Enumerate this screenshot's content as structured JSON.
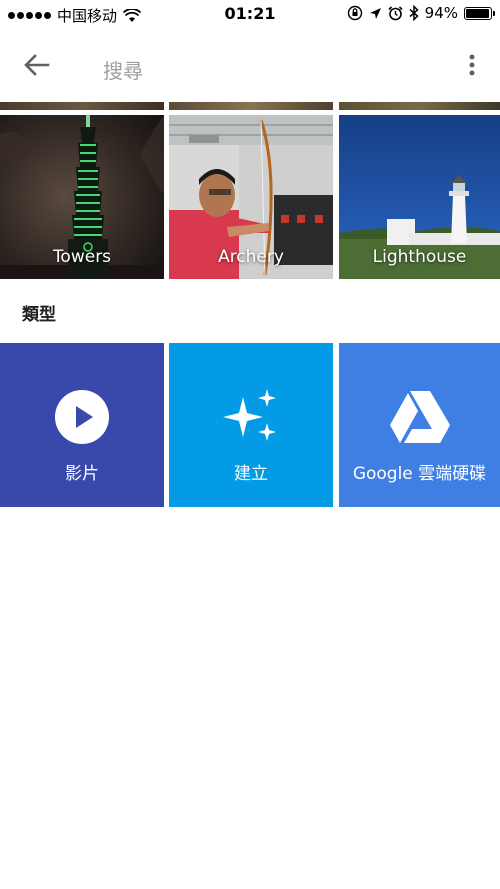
{
  "status_bar": {
    "carrier": "中国移动",
    "time": "01:21",
    "battery_percent": "94%",
    "battery_level": 0.94,
    "icons": [
      "signal-dots-icon",
      "wifi-icon",
      "orientation-lock-icon",
      "location-arrow-icon",
      "alarm-icon",
      "bluetooth-icon",
      "battery-icon"
    ]
  },
  "app_bar": {
    "search_placeholder": "搜尋",
    "back_icon": "arrow-back-icon",
    "more_icon": "more-vert-icon"
  },
  "photos": [
    {
      "label": "Towers",
      "icon": "towers-photo"
    },
    {
      "label": "Archery",
      "icon": "archery-photo"
    },
    {
      "label": "Lighthouse",
      "icon": "lighthouse-photo"
    }
  ],
  "types_section": {
    "heading": "類型",
    "items": [
      {
        "label": "影片",
        "icon": "play-circle-icon",
        "color": "#3949AB"
      },
      {
        "label": "建立",
        "icon": "sparkle-icon",
        "color": "#039BE5"
      },
      {
        "label": "Google 雲端硬碟",
        "icon": "google-drive-icon",
        "color": "#3F7FE3"
      }
    ]
  }
}
